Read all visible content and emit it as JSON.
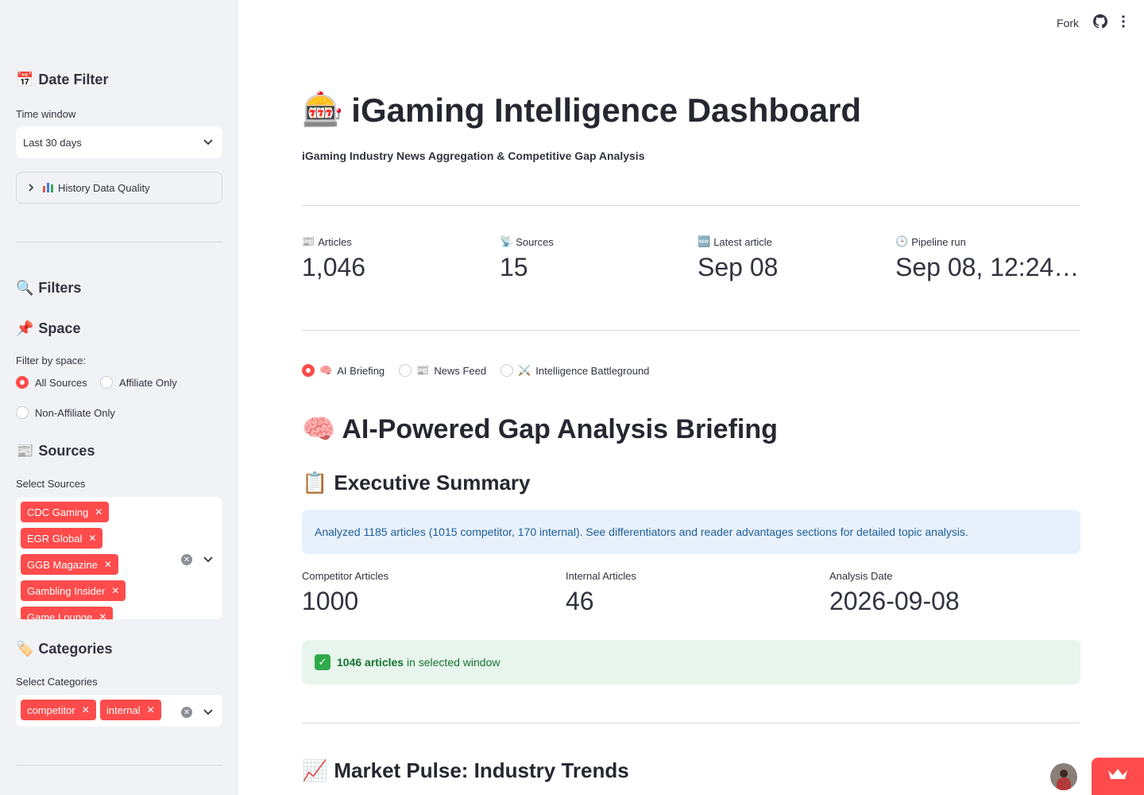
{
  "topbar": {
    "fork_label": "Fork"
  },
  "sidebar": {
    "date_filter": {
      "title": "Date Filter",
      "label": "Time window",
      "value": "Last 30 days"
    },
    "history_expander": "History Data Quality",
    "filters_title": "Filters",
    "space": {
      "title": "Space",
      "label": "Filter by space:",
      "options": [
        "All Sources",
        "Affiliate Only",
        "Non-Affiliate Only"
      ],
      "selected": "All Sources"
    },
    "sources": {
      "title": "Sources",
      "label": "Select Sources",
      "chips": [
        "CDC Gaming",
        "EGR Global",
        "GGB Magazine",
        "Gambling Insider",
        "Game Lounge"
      ]
    },
    "categories": {
      "title": "Categories",
      "label": "Select Categories",
      "chips": [
        "competitor",
        "internal"
      ]
    }
  },
  "main": {
    "title": "iGaming Intelligence Dashboard",
    "subtitle": "iGaming Industry News Aggregation & Competitive Gap Analysis",
    "metrics": [
      {
        "label": "Articles",
        "value": "1,046"
      },
      {
        "label": "Sources",
        "value": "15"
      },
      {
        "label": "Latest article",
        "value": "Sep 08"
      },
      {
        "label": "Pipeline run",
        "value": "Sep 08, 12:24…"
      }
    ],
    "tabs": [
      "AI Briefing",
      "News Feed",
      "Intelligence Battleground"
    ],
    "selected_tab": "AI Briefing",
    "briefing_title": "AI-Powered Gap Analysis Briefing",
    "exec_summary_title": "Executive Summary",
    "info_text": "Analyzed 1185 articles (1015 competitor, 170 internal). See differentiators and reader advantages sections for detailed topic analysis.",
    "stats": [
      {
        "label": "Competitor Articles",
        "value": "1000"
      },
      {
        "label": "Internal Articles",
        "value": "46"
      },
      {
        "label": "Analysis Date",
        "value": "2026-09-08"
      }
    ],
    "success_bold": "1046 articles",
    "success_rest": " in selected window",
    "market_title": "Market Pulse: Industry Trends"
  }
}
